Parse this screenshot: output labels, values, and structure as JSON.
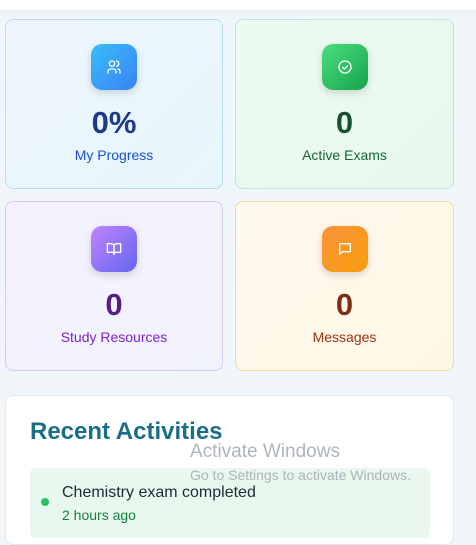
{
  "stats": [
    {
      "value": "0%",
      "label": "My Progress",
      "icon": "users-icon",
      "color": "#1e3a8a",
      "label_color": "#1d4ed8"
    },
    {
      "value": "0",
      "label": "Active Exams",
      "icon": "check-circle-icon",
      "color": "#14532d",
      "label_color": "#166534"
    },
    {
      "value": "0",
      "label": "Study Resources",
      "icon": "book-open-icon",
      "color": "#581c87",
      "label_color": "#7e22ce"
    },
    {
      "value": "0",
      "label": "Messages",
      "icon": "message-square-icon",
      "color": "#7c2d12",
      "label_color": "#9a3412"
    }
  ],
  "activities": {
    "title": "Recent Activities",
    "items": [
      {
        "title": "Chemistry exam completed",
        "time": "2 hours ago",
        "dot_color": "#22c55e"
      }
    ]
  },
  "watermark": {
    "line1": "Activate Windows",
    "line2": "Go to Settings to activate Windows."
  }
}
